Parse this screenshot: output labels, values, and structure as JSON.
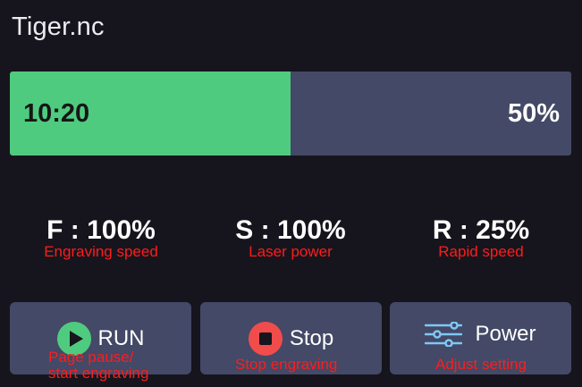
{
  "header": {
    "title": "Tiger.nc"
  },
  "progress": {
    "elapsed": "10:20",
    "percent_label": "50%",
    "fraction": 0.5,
    "fill_color": "#4fcb7f",
    "track_color": "#434966"
  },
  "stats": [
    {
      "value": "F : 100%",
      "annotation": "Engraving speed"
    },
    {
      "value": "S : 100%",
      "annotation": "Laser power"
    },
    {
      "value": "R : 25%",
      "annotation": "Rapid speed"
    }
  ],
  "buttons": {
    "run": {
      "label": "RUN",
      "icon": "play-icon",
      "icon_color": "#4fcb7f",
      "annotation_line1": "Page pause/",
      "annotation_line2": "start engraving"
    },
    "stop": {
      "label": "Stop",
      "icon": "stop-icon",
      "icon_color": "#f04c4c",
      "annotation": "Stop engraving"
    },
    "power": {
      "label": "Power",
      "icon": "sliders-icon",
      "icon_color": "#7ec8f5",
      "annotation": "Adjust setting"
    }
  },
  "colors": {
    "background": "#16151d",
    "panel": "#434966",
    "annotation": "#ff1c1c"
  }
}
